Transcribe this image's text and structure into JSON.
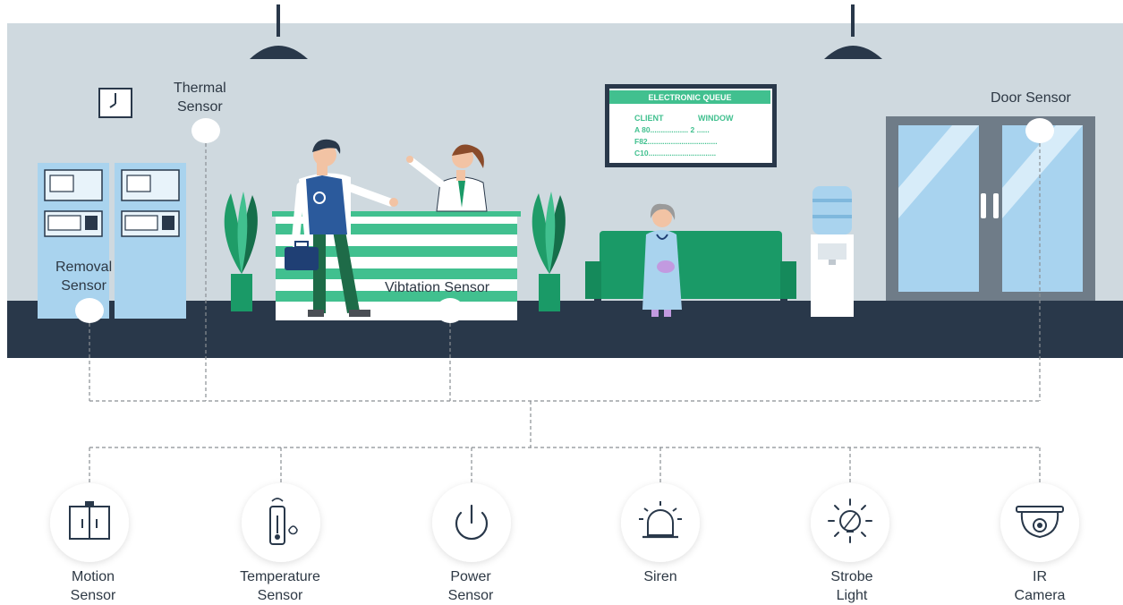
{
  "colors": {
    "wall": "#cfd9df",
    "floor": "#29384a",
    "accent_green": "#41c08f",
    "dark_green": "#1a9a67",
    "plant_green": "#1f9c68",
    "atm_blue": "#a9d3ee",
    "door_frame": "#7d8a96",
    "glass": "#a8d3ef",
    "text": "#2d3844",
    "dashed_line": "#8a8f94"
  },
  "scene": {
    "queue_board": {
      "title": "ELECTRONIC QUEUE",
      "col_client": "CLIENT",
      "col_window": "WINDOW",
      "row1": "A 80.................. 2 ......",
      "row2": "F82.................................",
      "row3": "C10................................"
    }
  },
  "sensors": {
    "thermal": [
      "Thermal",
      "Sensor"
    ],
    "removal": [
      "Removal",
      "Sensor"
    ],
    "vibration": "Vibtation Sensor",
    "door": "Door Sensor"
  },
  "devices": [
    {
      "icon": "motion-sensor-icon",
      "line1": "Motion",
      "line2": "Sensor"
    },
    {
      "icon": "temperature-sensor-icon",
      "line1": "Temperature",
      "line2": "Sensor"
    },
    {
      "icon": "power-sensor-icon",
      "line1": "Power",
      "line2": "Sensor"
    },
    {
      "icon": "siren-icon",
      "line1": "Siren",
      "line2": ""
    },
    {
      "icon": "strobe-light-icon",
      "line1": "Strobe",
      "line2": "Light"
    },
    {
      "icon": "ir-camera-icon",
      "line1": "IR",
      "line2": "Camera"
    }
  ]
}
